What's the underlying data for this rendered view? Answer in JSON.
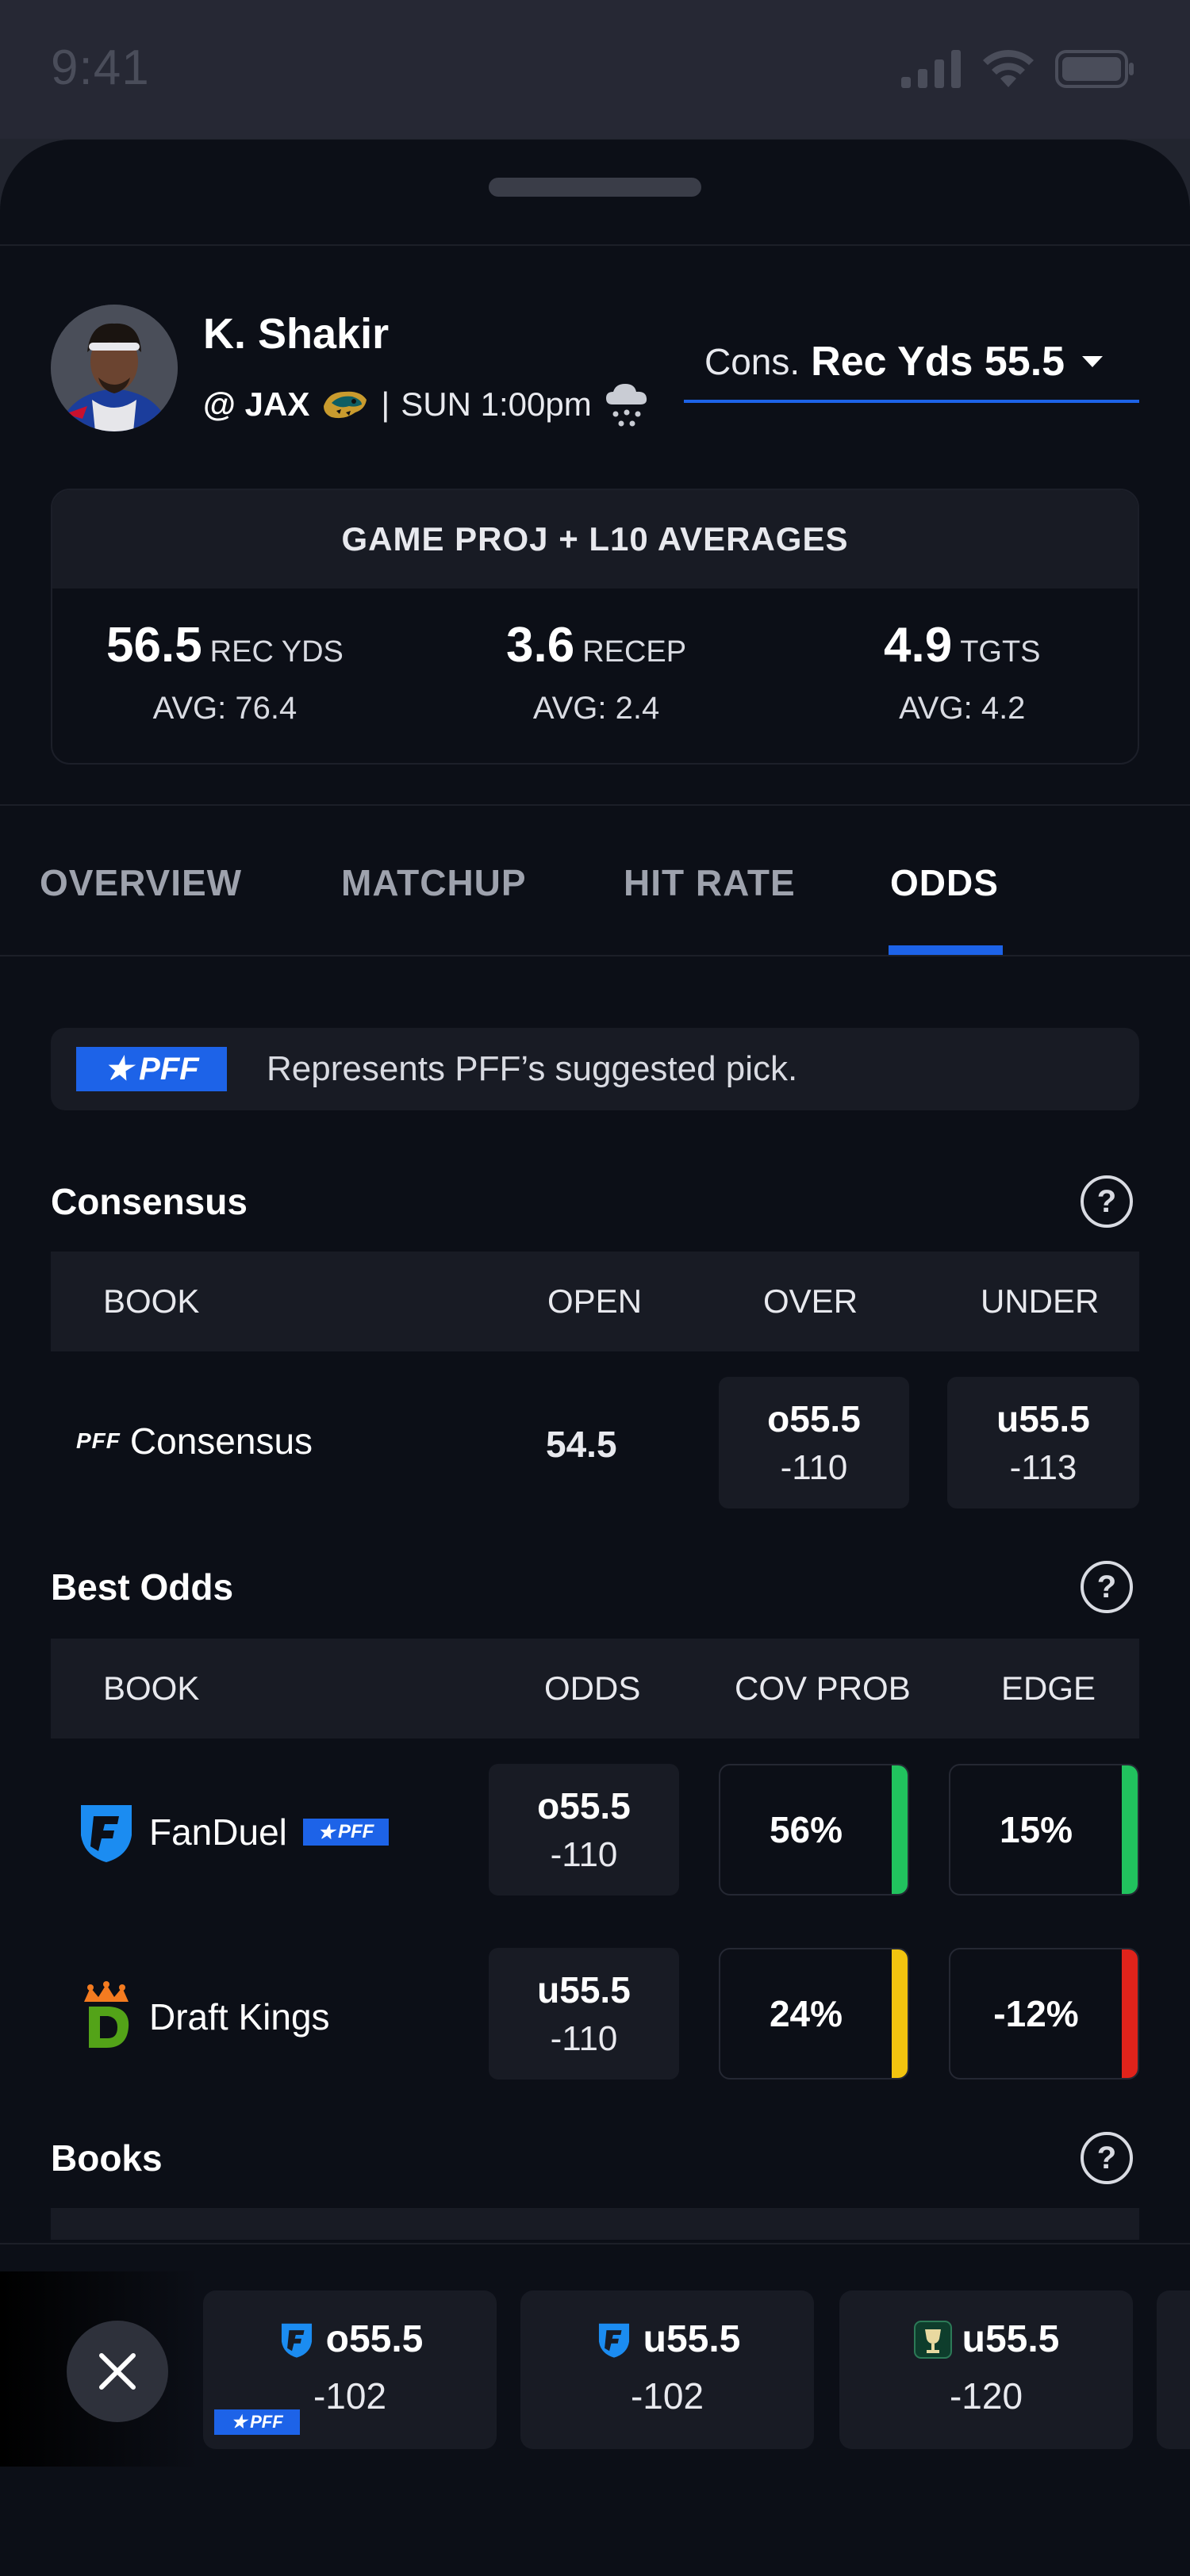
{
  "status": {
    "time": "9:41"
  },
  "player": {
    "name": "K. Shakir",
    "opponent": "@ JAX",
    "separator": "|",
    "game_time": "SUN 1:00pm"
  },
  "prop_selector": {
    "prefix": "Cons.",
    "value": "Rec Yds 55.5"
  },
  "projections": {
    "title": "GAME PROJ + L10 AVERAGES",
    "items": [
      {
        "value": "56.5",
        "unit": "REC YDS",
        "avg": "AVG: 76.4"
      },
      {
        "value": "3.6",
        "unit": "RECEP",
        "avg": "AVG: 2.4"
      },
      {
        "value": "4.9",
        "unit": "TGTS",
        "avg": "AVG: 4.2"
      }
    ]
  },
  "tabs": [
    "OVERVIEW",
    "MATCHUP",
    "HIT RATE",
    "ODDS"
  ],
  "active_tab": "ODDS",
  "legend": {
    "badge": "PFF",
    "text": "Represents PFF’s suggested pick."
  },
  "consensus": {
    "title": "Consensus",
    "headers": [
      "BOOK",
      "OPEN",
      "OVER",
      "UNDER"
    ],
    "row": {
      "book_logo": "PFF",
      "book": "Consensus",
      "open": "54.5",
      "over": {
        "line": "o55.5",
        "price": "-110"
      },
      "under": {
        "line": "u55.5",
        "price": "-113"
      }
    }
  },
  "best_odds": {
    "title": "Best Odds",
    "headers": [
      "BOOK",
      "ODDS",
      "COV PROB",
      "EDGE"
    ],
    "rows": [
      {
        "book": "FanDuel",
        "badge": "PFF",
        "line": "o55.5",
        "price": "-110",
        "cov_prob": "56%",
        "edge": "15%",
        "cov_color": "#21c25e",
        "edge_color": "#21c25e"
      },
      {
        "book": "Draft Kings",
        "line": "u55.5",
        "price": "-110",
        "cov_prob": "24%",
        "edge": "-12%",
        "cov_color": "#f2c40f",
        "edge_color": "#e0231b"
      }
    ]
  },
  "books": {
    "title": "Books"
  },
  "tray": [
    {
      "icon": "fanduel-icon",
      "line": "o55.5",
      "price": "-102",
      "badge": "PFF"
    },
    {
      "icon": "fanduel-icon",
      "line": "u55.5",
      "price": "-102"
    },
    {
      "icon": "book-icon",
      "line": "u55.5",
      "price": "-120"
    }
  ],
  "colors": {
    "accent": "#1d63e8",
    "bg": "#0c0f17",
    "surface": "#181b24"
  }
}
